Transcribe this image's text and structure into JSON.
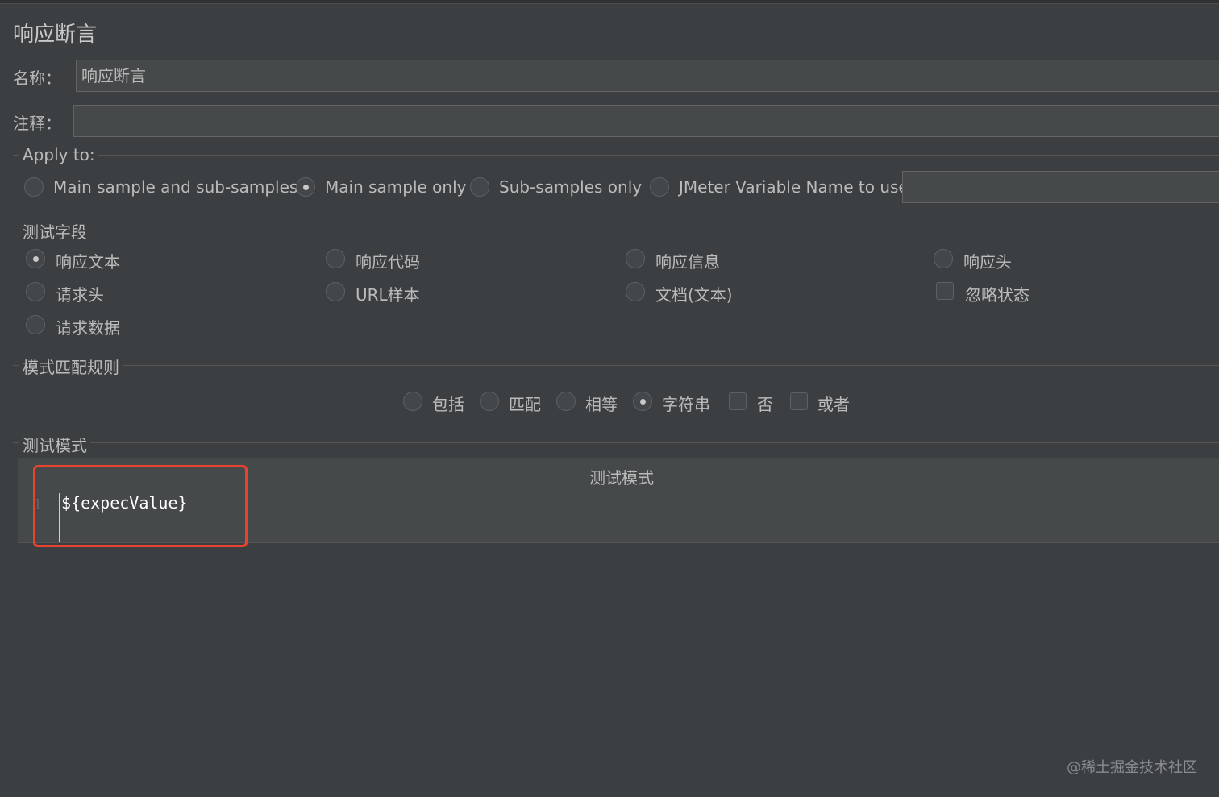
{
  "title": "响应断言",
  "name_field": {
    "label": "名称：",
    "value": "响应断言"
  },
  "comment_field": {
    "label": "注释：",
    "value": ""
  },
  "apply_to": {
    "label": "Apply to:",
    "options": [
      "Main sample and sub-samples",
      "Main sample only",
      "Sub-samples only",
      "JMeter Variable Name to use"
    ],
    "selected": "Main sample only",
    "variable_value": ""
  },
  "test_field": {
    "label": "测试字段",
    "options": [
      "响应文本",
      "响应代码",
      "响应信息",
      "响应头",
      "请求头",
      "URL样本",
      "文档(文本)",
      "请求数据"
    ],
    "selected": "响应文本",
    "checkbox": {
      "label": "忽略状态",
      "checked": false
    }
  },
  "pattern_rules": {
    "label": "模式匹配规则",
    "radios": [
      "包括",
      "匹配",
      "相等",
      "字符串"
    ],
    "selected": "字符串",
    "checkboxes": [
      {
        "label": "否",
        "checked": false
      },
      {
        "label": "或者",
        "checked": false
      }
    ]
  },
  "test_patterns": {
    "label": "测试模式",
    "column_header": "测试模式",
    "line_number": "1",
    "code": "${expecValue}"
  },
  "watermark": "@稀土掘金技术社区",
  "colors": {
    "background": "#3c3f41",
    "field": "#45494a",
    "highlight": "#e8432e"
  }
}
